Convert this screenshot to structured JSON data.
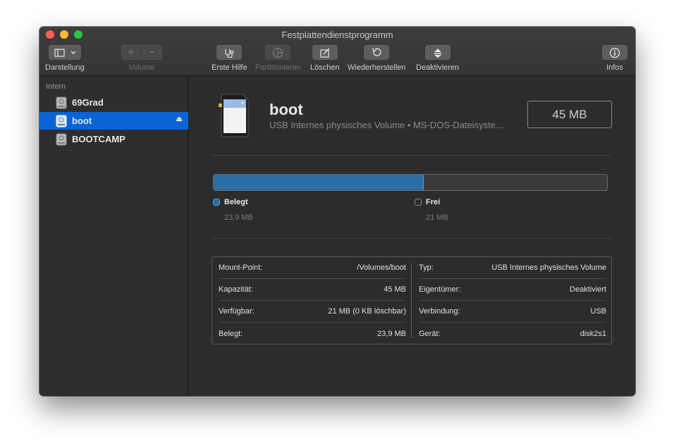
{
  "window": {
    "title": "Festplattendienstprogramm"
  },
  "toolbar": {
    "view_label": "Darstellung",
    "volume_label": "Volume",
    "first_aid_label": "Erste Hilfe",
    "partition_label": "Partitionieren",
    "erase_label": "Löschen",
    "restore_label": "Wiederherstellen",
    "unmount_label": "Deaktivieren",
    "info_label": "Infos"
  },
  "sidebar": {
    "section": "Intern",
    "items": [
      {
        "label": "69Grad",
        "icon": "internal-disk-icon",
        "selected": false
      },
      {
        "label": "boot",
        "icon": "internal-disk-icon",
        "selected": true
      },
      {
        "label": "BOOTCAMP",
        "icon": "internal-disk-icon",
        "selected": false
      }
    ]
  },
  "volume": {
    "name": "boot",
    "subtitle": "USB Internes physisches Volume • MS-DOS-Dateisyste…",
    "size": "45 MB",
    "icon": "sd-card-icon"
  },
  "usage": {
    "used_fraction": 0.534,
    "used_label": "Belegt",
    "used_value": "23,9 MB",
    "free_label": "Frei",
    "free_value": "21 MB",
    "used_color": "#2a6ea6"
  },
  "details": {
    "left": [
      {
        "key": "Mount-Point:",
        "value": "/Volumes/boot"
      },
      {
        "key": "Kapazität:",
        "value": "45 MB"
      },
      {
        "key": "Verfügbar:",
        "value": "21 MB (0 KB löschbar)"
      },
      {
        "key": "Belegt:",
        "value": "23,9 MB"
      }
    ],
    "right": [
      {
        "key": "Typ:",
        "value": "USB Internes physisches Volume"
      },
      {
        "key": "Eigentümer:",
        "value": "Deaktiviert"
      },
      {
        "key": "Verbindung:",
        "value": "USB"
      },
      {
        "key": "Gerät:",
        "value": "disk2s1"
      }
    ]
  }
}
